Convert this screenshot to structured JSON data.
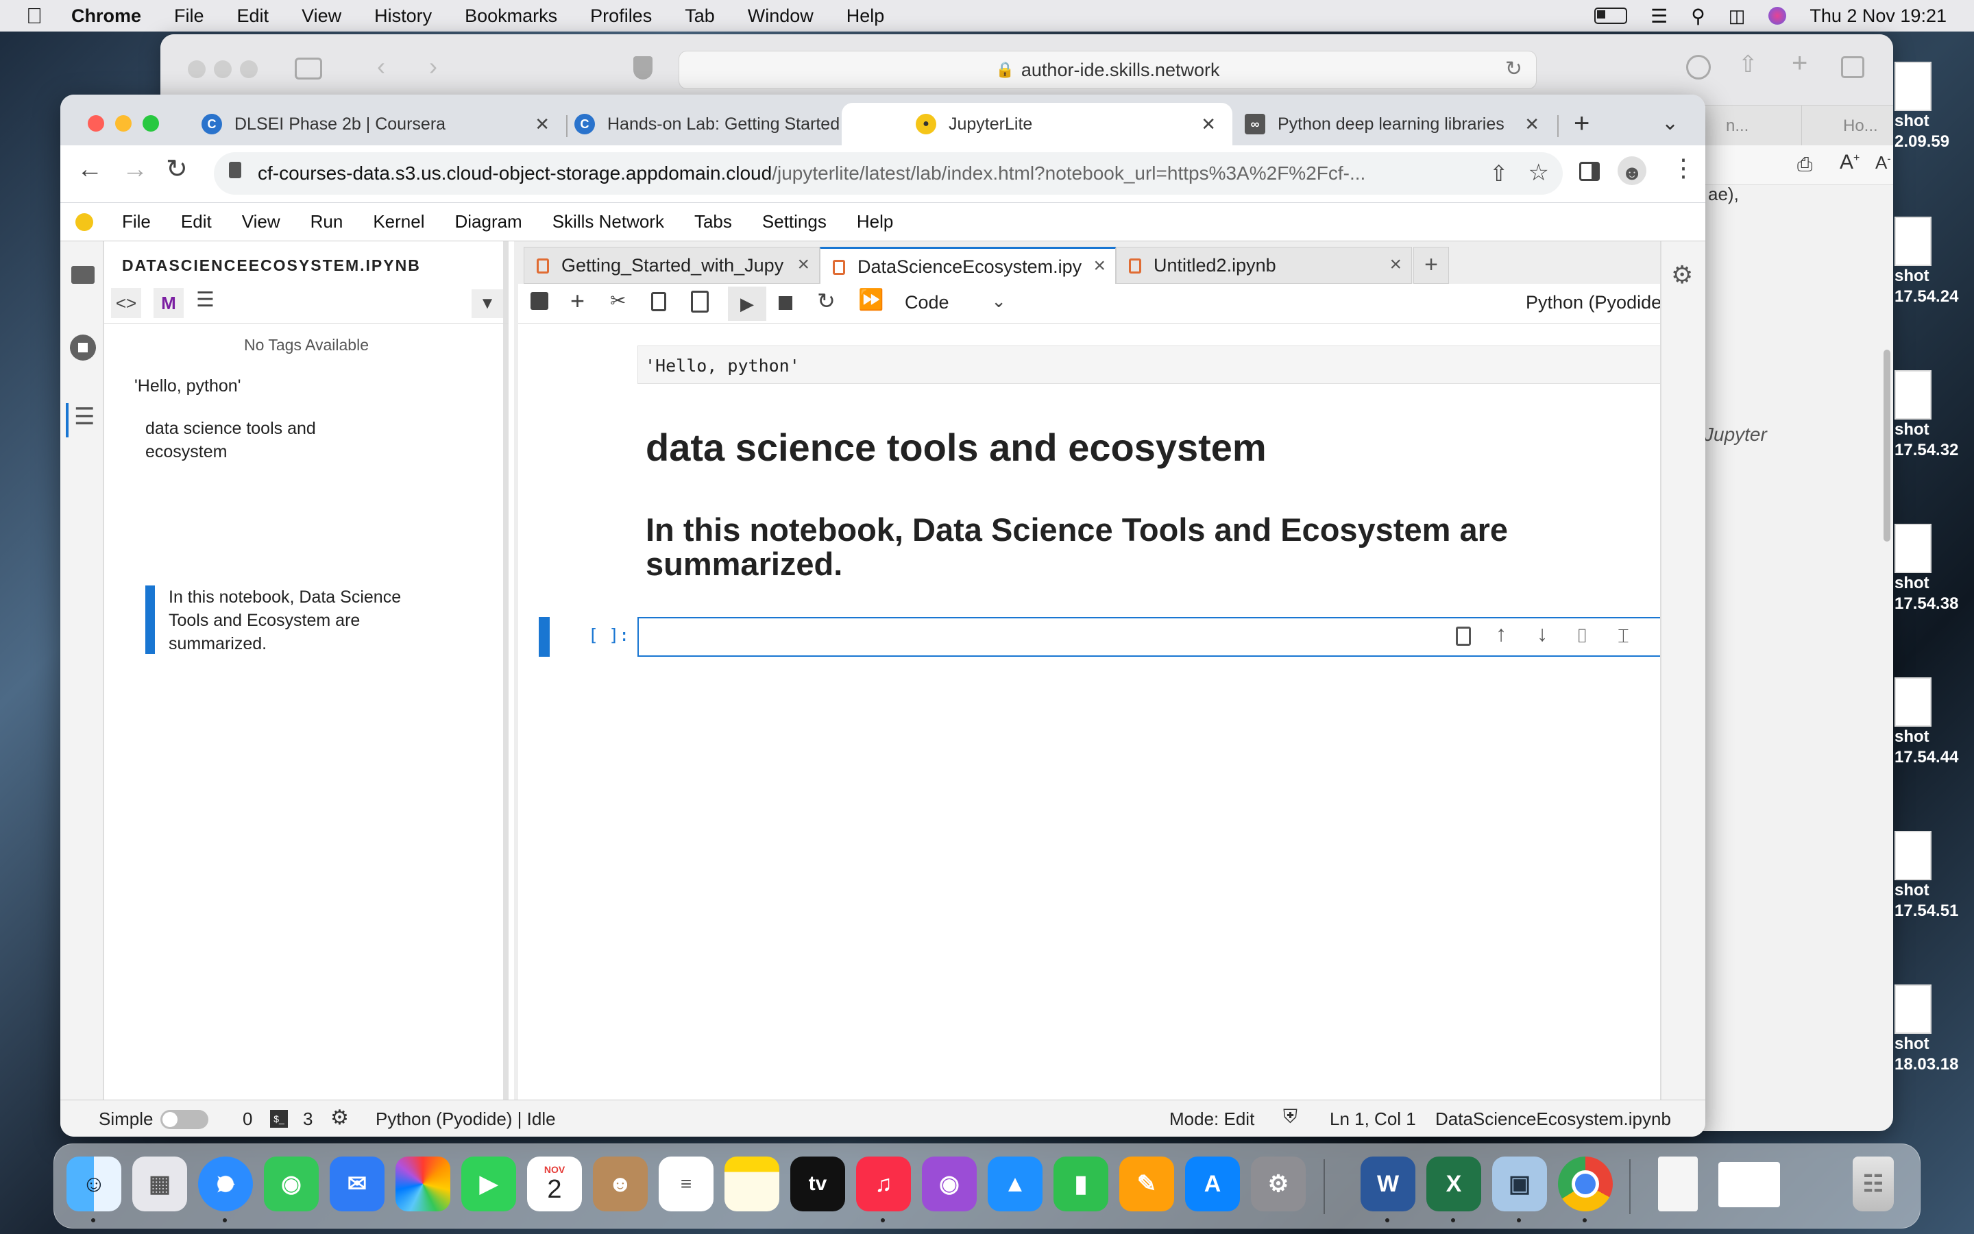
{
  "menubar": {
    "app": "Chrome",
    "items": [
      "File",
      "Edit",
      "View",
      "History",
      "Bookmarks",
      "Profiles",
      "Tab",
      "Window",
      "Help"
    ],
    "datetime": "Thu 2 Nov  19:21"
  },
  "safari": {
    "url": "author-ide.skills.network",
    "tab_partial_1": "n...",
    "tab_partial_2": "Ho...",
    "doc_text_1": "ae),",
    "doc_text_2": "Jupyter"
  },
  "desktop_files": [
    {
      "line1": "shot",
      "line2": "2.09.59"
    },
    {
      "line1": "shot",
      "line2": "17.54.24"
    },
    {
      "line1": "shot",
      "line2": "17.54.32"
    },
    {
      "line1": "shot",
      "line2": "17.54.38"
    },
    {
      "line1": "shot",
      "line2": "17.54.44"
    },
    {
      "line1": "shot",
      "line2": "17.54.51"
    },
    {
      "line1": "shot",
      "line2": "18.03.18"
    }
  ],
  "chrome": {
    "tabs": [
      {
        "label": "DLSEI Phase 2b | Coursera",
        "icon": "coursera-icon"
      },
      {
        "label": "Hands-on Lab: Getting Started",
        "icon": "coursera-icon"
      },
      {
        "label": "JupyterLite",
        "icon": "jupyterlite-icon",
        "active": true
      },
      {
        "label": "Python deep learning libraries",
        "icon": "skills-network-icon"
      }
    ],
    "url_host": "cf-courses-data.s3.us.cloud-object-storage.appdomain.cloud",
    "url_path": "/jupyterlite/latest/lab/index.html?notebook_url=https%3A%2F%2Fcf-..."
  },
  "jupyter": {
    "menu": [
      "File",
      "Edit",
      "View",
      "Run",
      "Kernel",
      "Diagram",
      "Skills Network",
      "Tabs",
      "Settings",
      "Help"
    ],
    "toc": {
      "title": "DATASCIENCEECOSYSTEM.IPYNB",
      "no_tags": "No Tags Available",
      "items": [
        "'Hello, python'",
        "data science tools and ecosystem",
        "In this notebook, Data Science Tools and Ecosystem are summarized."
      ]
    },
    "doc_tabs": [
      {
        "label": "Getting_Started_with_Jupy"
      },
      {
        "label": "DataScienceEcosystem.ipy",
        "active": true
      },
      {
        "label": "Untitled2.ipynb"
      }
    ],
    "cell_type": "Code",
    "kernel": "Python (Pyodide)",
    "cells": {
      "output": "'Hello, python'",
      "heading1": "data science tools and ecosystem",
      "heading2": "In this notebook, Data Science Tools and Ecosystem are summarized.",
      "prompt": "[ ]:"
    },
    "status": {
      "simple": "Simple",
      "terminals": "0",
      "kernels": "3",
      "kernel_state": "Python (Pyodide) | Idle",
      "mode": "Mode: Edit",
      "position": "Ln 1, Col 1",
      "filename": "DataScienceEcosystem.ipynb"
    }
  },
  "dock": {
    "calendar_month": "NOV",
    "calendar_day": "2",
    "tv_label": "tv"
  },
  "colors": {
    "accent_blue": "#1a73e8",
    "jupyter_orange": "#e06c33",
    "cell_select": "#1976d2"
  }
}
